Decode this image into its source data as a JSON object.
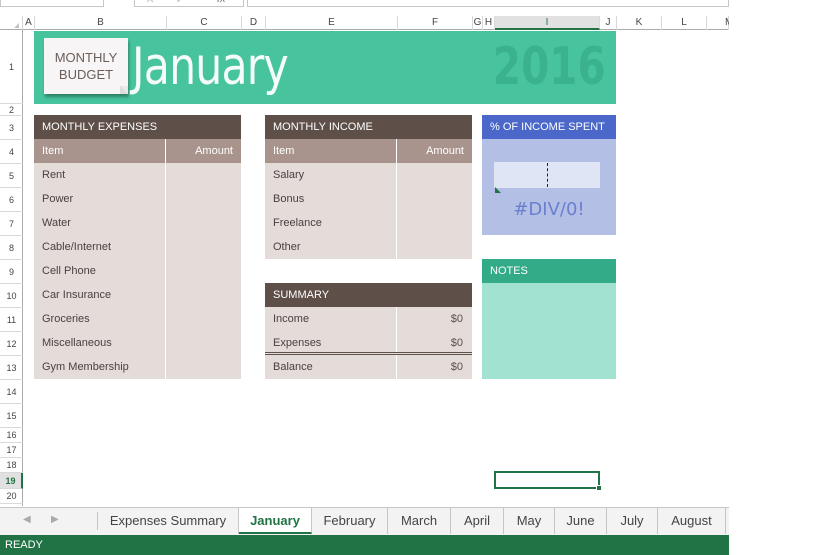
{
  "formula_bar": {
    "fx_label": "fx"
  },
  "columns": [
    "A",
    "B",
    "C",
    "D",
    "E",
    "F",
    "G",
    "H",
    "I",
    "J",
    "K",
    "L",
    "M"
  ],
  "active_column": "I",
  "rows": [
    "1",
    "2",
    "3",
    "4",
    "5",
    "6",
    "7",
    "8",
    "9",
    "10",
    "11",
    "12",
    "13",
    "14",
    "15",
    "16",
    "17",
    "18",
    "19",
    "20"
  ],
  "active_row": "19",
  "banner": {
    "badge_line1": "MONTHLY",
    "badge_line2": "BUDGET",
    "month": "January",
    "year": "2016"
  },
  "expenses": {
    "title": "MONTHLY EXPENSES",
    "col_item": "Item",
    "col_amount": "Amount",
    "items": [
      {
        "item": "Rent",
        "amount": ""
      },
      {
        "item": "Power",
        "amount": ""
      },
      {
        "item": "Water",
        "amount": ""
      },
      {
        "item": "Cable/Internet",
        "amount": ""
      },
      {
        "item": "Cell Phone",
        "amount": ""
      },
      {
        "item": "Car Insurance",
        "amount": ""
      },
      {
        "item": "Groceries",
        "amount": ""
      },
      {
        "item": "Miscellaneous",
        "amount": ""
      },
      {
        "item": "Gym Membership",
        "amount": ""
      }
    ]
  },
  "income": {
    "title": "MONTHLY INCOME",
    "col_item": "Item",
    "col_amount": "Amount",
    "items": [
      {
        "item": "Salary",
        "amount": ""
      },
      {
        "item": "Bonus",
        "amount": ""
      },
      {
        "item": "Freelance",
        "amount": ""
      },
      {
        "item": "Other",
        "amount": ""
      }
    ]
  },
  "summary": {
    "title": "SUMMARY",
    "rows": [
      {
        "label": "Income",
        "value": "$0"
      },
      {
        "label": "Expenses",
        "value": "$0"
      },
      {
        "label": "Balance",
        "value": "$0"
      }
    ]
  },
  "percent_spent": {
    "title": "% OF INCOME SPENT",
    "value": "#DIV/0!"
  },
  "notes": {
    "title": "NOTES",
    "content": ""
  },
  "sheet_tabs": {
    "active": "January",
    "tabs": [
      "Expenses Summary",
      "January",
      "February",
      "March",
      "April",
      "May",
      "June",
      "July",
      "August"
    ]
  },
  "status_bar": {
    "mode": "READY"
  },
  "colors": {
    "banner": "#47c49e",
    "table_header": "#5e4f48",
    "table_subheader": "#a8948c",
    "table_body": "#e3dcd9",
    "percent_header": "#4a67c9",
    "percent_body": "#b4bfe6",
    "notes_header": "#33aa88",
    "notes_body": "#a1e2d0",
    "excel_green": "#217346"
  }
}
